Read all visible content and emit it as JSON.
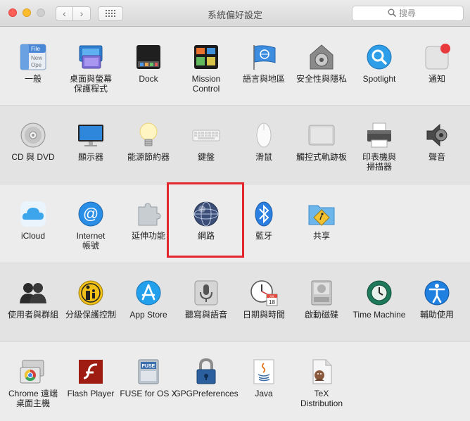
{
  "window": {
    "title": "系統偏好設定",
    "search_placeholder": "搜尋",
    "back_icon": "chevron-left-icon",
    "forward_icon": "chevron-right-icon",
    "show_all_icon": "grid-icon"
  },
  "highlight_color": "#e2262b",
  "rows": [
    [
      {
        "label": "一般",
        "icon": "general-icon"
      },
      {
        "label": "桌面與螢幕\n保護程式",
        "icon": "desktop-screensaver-icon"
      },
      {
        "label": "Dock",
        "icon": "dock-icon"
      },
      {
        "label": "Mission\nControl",
        "icon": "mission-control-icon"
      },
      {
        "label": "語言與地區",
        "icon": "language-region-icon"
      },
      {
        "label": "安全性與隱私",
        "icon": "security-privacy-icon"
      },
      {
        "label": "Spotlight",
        "icon": "spotlight-icon"
      },
      {
        "label": "通知",
        "icon": "notifications-icon"
      }
    ],
    [
      {
        "label": "CD 與 DVD",
        "icon": "cd-dvd-icon"
      },
      {
        "label": "顯示器",
        "icon": "displays-icon"
      },
      {
        "label": "能源節約器",
        "icon": "energy-saver-icon"
      },
      {
        "label": "鍵盤",
        "icon": "keyboard-icon"
      },
      {
        "label": "滑鼠",
        "icon": "mouse-icon"
      },
      {
        "label": "觸控式軌跡板",
        "icon": "trackpad-icon"
      },
      {
        "label": "印表機與\n掃描器",
        "icon": "printers-scanners-icon"
      },
      {
        "label": "聲音",
        "icon": "sound-icon"
      }
    ],
    [
      {
        "label": "iCloud",
        "icon": "icloud-icon"
      },
      {
        "label": "Internet\n帳號",
        "icon": "internet-accounts-icon"
      },
      {
        "label": "延伸功能",
        "icon": "extensions-icon"
      },
      {
        "label": "網路",
        "icon": "network-icon"
      },
      {
        "label": "藍牙",
        "icon": "bluetooth-icon"
      },
      {
        "label": "共享",
        "icon": "sharing-icon"
      }
    ],
    [
      {
        "label": "使用者與群組",
        "icon": "users-groups-icon"
      },
      {
        "label": "分級保護控制",
        "icon": "parental-controls-icon"
      },
      {
        "label": "App Store",
        "icon": "app-store-icon"
      },
      {
        "label": "聽寫與語音",
        "icon": "dictation-speech-icon"
      },
      {
        "label": "日期與時間",
        "icon": "date-time-icon"
      },
      {
        "label": "啟動磁碟",
        "icon": "startup-disk-icon"
      },
      {
        "label": "Time Machine",
        "icon": "time-machine-icon"
      },
      {
        "label": "輔助使用",
        "icon": "accessibility-icon"
      }
    ],
    [
      {
        "label": "Chrome 遠端\n桌面主機",
        "icon": "chrome-remote-desktop-icon"
      },
      {
        "label": "Flash Player",
        "icon": "flash-player-icon"
      },
      {
        "label": "FUSE for OS X",
        "icon": "fuse-icon"
      },
      {
        "label": "GPGPreferences",
        "icon": "gpg-preferences-icon"
      },
      {
        "label": "Java",
        "icon": "java-icon"
      },
      {
        "label": "TeX\nDistribution",
        "icon": "tex-distribution-icon"
      }
    ]
  ],
  "icon_text": {
    "general": [
      "File",
      "New",
      "Ope"
    ],
    "date_month": "JUL",
    "date_day": "18",
    "fuse": "FUSE"
  }
}
